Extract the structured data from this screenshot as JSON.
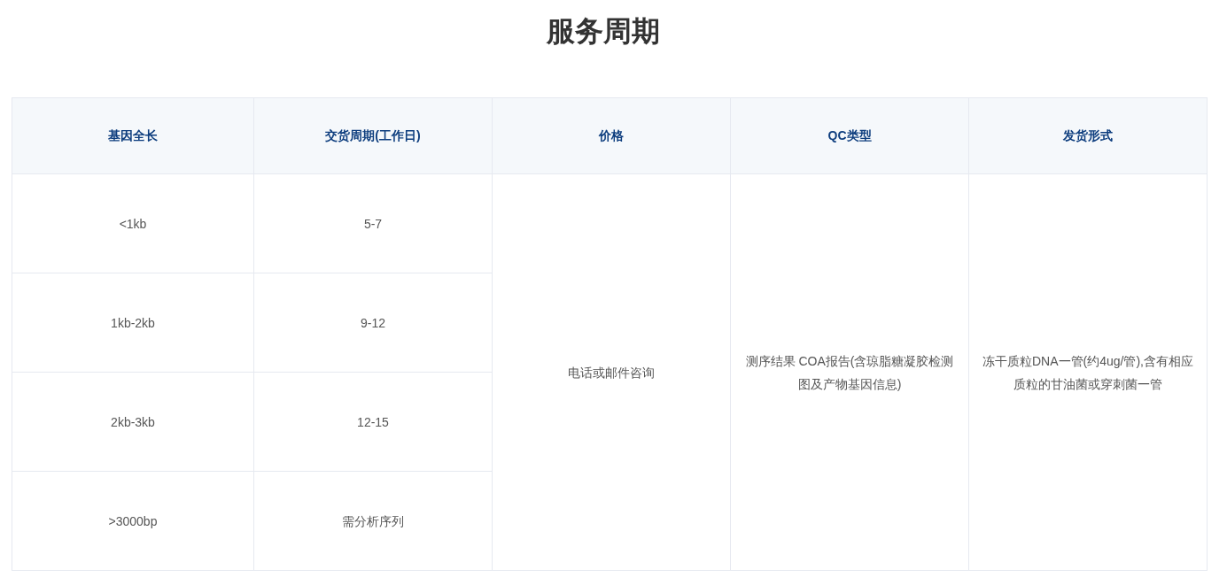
{
  "title": "服务周期",
  "table": {
    "columns": [
      "基因全长",
      "交货周期(工作日)",
      "价格",
      "QC类型",
      "发货形式"
    ],
    "rows": [
      {
        "gene_length": "<1kb",
        "turnaround": "5-7"
      },
      {
        "gene_length": "1kb-2kb",
        "turnaround": "9-12"
      },
      {
        "gene_length": "2kb-3kb",
        "turnaround": "12-15"
      },
      {
        "gene_length": ">3000bp",
        "turnaround": "需分析序列"
      }
    ],
    "price": "电话或邮件咨询",
    "qc_type": "测序结果 COA报告(含琼脂糖凝胶检测图及产物基因信息)",
    "shipping": "冻干质粒DNA一管(约4ug/管),含有相应质粒的甘油菌或穿刺菌一管"
  }
}
